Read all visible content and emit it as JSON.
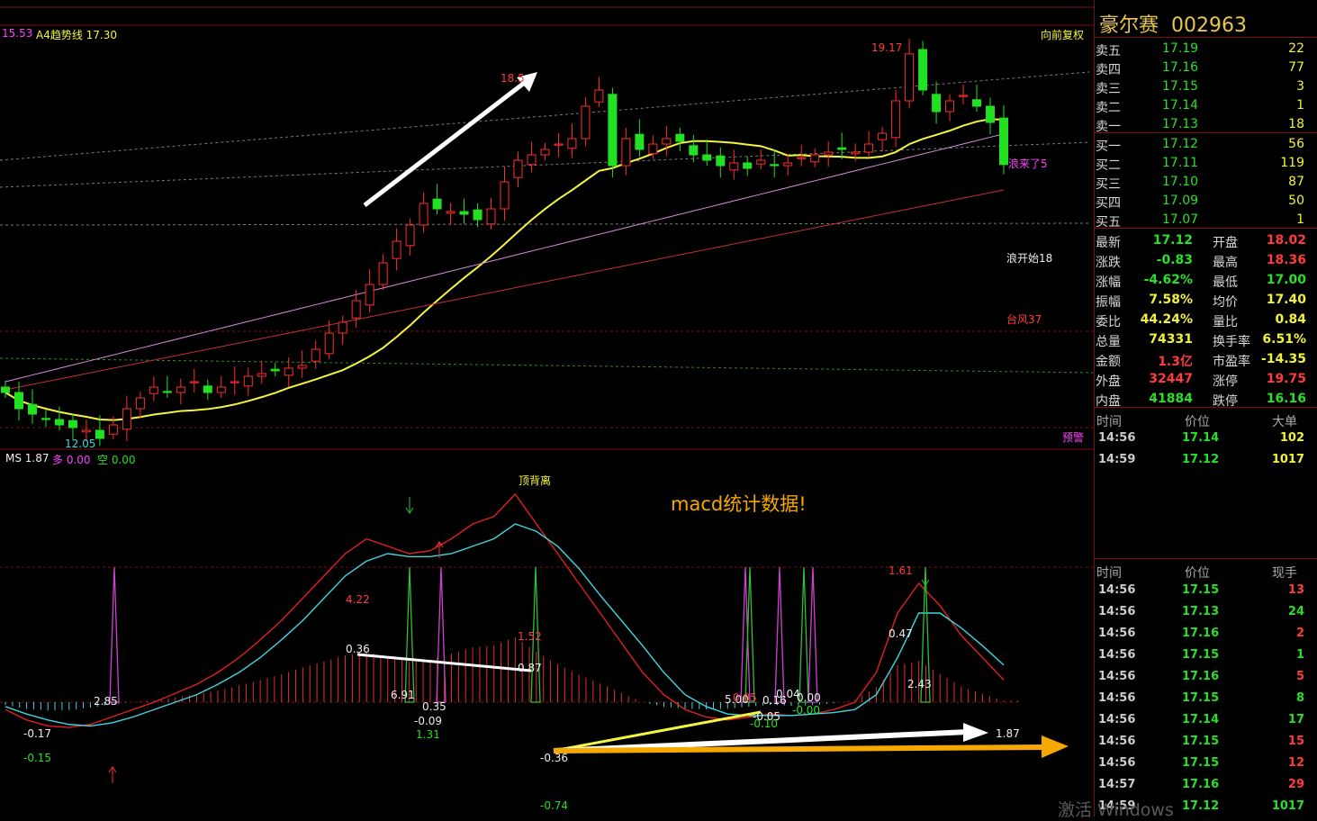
{
  "colors": {
    "up": "#ff2d2d",
    "down": "#22e022",
    "ma": "#f5f540",
    "ma_pink": "#d98ad8",
    "ma_red": "#c03030",
    "dif": "#e02020",
    "dea": "#3fd6e0",
    "accent": "#f5a800"
  },
  "header": {
    "left_value": "15.53",
    "indicator": "A4趋势线 17.30",
    "right_label": "向前复权"
  },
  "stock": {
    "name": "豪尔赛",
    "code": "002963"
  },
  "order_book": {
    "sell": [
      {
        "label": "卖五",
        "price": "17.19",
        "vol": "22"
      },
      {
        "label": "卖四",
        "price": "17.16",
        "vol": "77"
      },
      {
        "label": "卖三",
        "price": "17.15",
        "vol": "3"
      },
      {
        "label": "卖二",
        "price": "17.14",
        "vol": "1"
      },
      {
        "label": "卖一",
        "price": "17.13",
        "vol": "18"
      }
    ],
    "buy": [
      {
        "label": "买一",
        "price": "17.12",
        "vol": "56"
      },
      {
        "label": "买二",
        "price": "17.11",
        "vol": "119"
      },
      {
        "label": "买三",
        "price": "17.10",
        "vol": "87"
      },
      {
        "label": "买四",
        "price": "17.09",
        "vol": "50"
      },
      {
        "label": "买五",
        "price": "17.07",
        "vol": "1"
      }
    ]
  },
  "quote": [
    {
      "k1": "最新",
      "v1": "17.12",
      "c1": "green",
      "k2": "开盘",
      "v2": "18.02",
      "c2": "red"
    },
    {
      "k1": "涨跌",
      "v1": "-0.83",
      "c1": "green",
      "k2": "最高",
      "v2": "18.36",
      "c2": "red"
    },
    {
      "k1": "涨幅",
      "v1": "-4.62%",
      "c1": "green",
      "k2": "最低",
      "v2": "17.00",
      "c2": "green"
    },
    {
      "k1": "振幅",
      "v1": "7.58%",
      "c1": "yellow",
      "k2": "均价",
      "v2": "17.40",
      "c2": "yellow"
    },
    {
      "k1": "委比",
      "v1": "44.24%",
      "c1": "yellow",
      "k2": "量比",
      "v2": "0.84",
      "c2": "yellow"
    },
    {
      "k1": "总量",
      "v1": "74331",
      "c1": "yellow",
      "k2": "换手率",
      "v2": "6.51%",
      "c2": "yellow"
    },
    {
      "k1": "金额",
      "v1": "1.3亿",
      "c1": "red",
      "k2": "市盈率",
      "v2": "-14.35",
      "c2": "yellow"
    },
    {
      "k1": "外盘",
      "v1": "32447",
      "c1": "red",
      "k2": "涨停",
      "v2": "19.75",
      "c2": "red"
    },
    {
      "k1": "内盘",
      "v1": "41884",
      "c1": "green",
      "k2": "跌停",
      "v2": "16.16",
      "c2": "green"
    }
  ],
  "big_trades": {
    "headers": [
      "时间",
      "价位",
      "大单"
    ],
    "rows": [
      {
        "t": "14:56",
        "p": "17.14",
        "v": "102"
      },
      {
        "t": "14:59",
        "p": "17.12",
        "v": "1017"
      }
    ]
  },
  "ticks": {
    "headers": [
      "时间",
      "价位",
      "现手"
    ],
    "rows": [
      {
        "t": "14:56",
        "p": "17.15",
        "v": "13",
        "vc": "red"
      },
      {
        "t": "14:56",
        "p": "17.13",
        "v": "24",
        "vc": "green"
      },
      {
        "t": "14:56",
        "p": "17.16",
        "v": "2",
        "vc": "red"
      },
      {
        "t": "14:56",
        "p": "17.15",
        "v": "1",
        "vc": "green"
      },
      {
        "t": "14:56",
        "p": "17.16",
        "v": "5",
        "vc": "red"
      },
      {
        "t": "14:56",
        "p": "17.15",
        "v": "8",
        "vc": "green"
      },
      {
        "t": "14:56",
        "p": "17.14",
        "v": "17",
        "vc": "green"
      },
      {
        "t": "14:56",
        "p": "17.15",
        "v": "15",
        "vc": "red"
      },
      {
        "t": "14:56",
        "p": "17.15",
        "v": "12",
        "vc": "red"
      },
      {
        "t": "14:57",
        "p": "17.16",
        "v": "29",
        "vc": "red"
      },
      {
        "t": "14:59",
        "p": "17.12",
        "v": "1017",
        "vc": "green"
      }
    ]
  },
  "watermark": "激活 Windows",
  "chart_data": [
    {
      "type": "candlestick",
      "price_axis_range": [
        12.0,
        19.5
      ],
      "price_labels": {
        "low": "12.05",
        "peak1": "18.5",
        "high": "19.17",
        "last_close": "17.12"
      },
      "closes": [
        12.9,
        12.6,
        12.5,
        12.4,
        12.3,
        12.25,
        12.2,
        12.05,
        12.3,
        12.6,
        12.8,
        13.0,
        12.9,
        13.0,
        13.1,
        12.9,
        13.0,
        13.1,
        13.2,
        13.25,
        13.3,
        13.35,
        13.4,
        13.7,
        14.0,
        14.2,
        14.6,
        14.9,
        15.3,
        15.7,
        16.0,
        16.4,
        16.3,
        16.25,
        16.2,
        16.1,
        16.3,
        16.8,
        17.2,
        17.3,
        17.4,
        17.5,
        17.6,
        18.2,
        18.5,
        17.1,
        17.6,
        17.4,
        17.5,
        17.6,
        17.55,
        17.3,
        17.2,
        17.1,
        17.15,
        17.05,
        17.2,
        17.1,
        17.15,
        17.25,
        17.3,
        17.35,
        17.4,
        17.35,
        17.5,
        17.7,
        18.3,
        19.17,
        18.5,
        18.1,
        18.3,
        18.4,
        18.2,
        17.9,
        17.12
      ],
      "annotations": [
        "浪来了5",
        "浪开始18",
        "台风37",
        "预警"
      ]
    },
    {
      "type": "macd",
      "title": "MS 1.87",
      "legend": [
        {
          "label": "多 0.00",
          "color": "#ff40ff"
        },
        {
          "label": "空 0.00",
          "color": "#22e022"
        }
      ],
      "dif": [
        -0.05,
        -0.12,
        -0.16,
        -0.17,
        -0.15,
        -0.1,
        -0.05,
        0.0,
        0.06,
        0.12,
        0.2,
        0.3,
        0.42,
        0.55,
        0.7,
        0.85,
        1.0,
        1.1,
        1.05,
        1.0,
        1.02,
        1.1,
        1.2,
        1.25,
        1.4,
        1.2,
        1.0,
        0.8,
        0.6,
        0.4,
        0.2,
        0.05,
        -0.05,
        -0.1,
        -0.12,
        -0.1,
        -0.08,
        -0.09,
        -0.08,
        -0.05,
        0.0,
        0.2,
        0.6,
        0.8,
        0.65,
        0.45,
        0.3,
        0.15
      ],
      "dea": [
        -0.03,
        -0.08,
        -0.12,
        -0.15,
        -0.16,
        -0.14,
        -0.1,
        -0.05,
        0.0,
        0.05,
        0.12,
        0.2,
        0.3,
        0.42,
        0.55,
        0.7,
        0.85,
        0.95,
        1.0,
        0.98,
        0.98,
        1.0,
        1.05,
        1.1,
        1.2,
        1.15,
        1.05,
        0.9,
        0.72,
        0.55,
        0.38,
        0.2,
        0.05,
        -0.03,
        -0.08,
        -0.09,
        -0.09,
        -0.09,
        -0.08,
        -0.07,
        -0.05,
        0.05,
        0.3,
        0.6,
        0.6,
        0.5,
        0.38,
        0.25
      ],
      "labels": [
        "顶背离",
        "4.22",
        "1.52",
        "0.36",
        "0.87",
        "6.91",
        "0.35",
        "-0.09",
        "1.31",
        "-0.17",
        "-0.15",
        "2.85",
        "-0.36",
        "-0.74",
        "1.61",
        "0.47",
        "2.43",
        "1.87",
        "0.05",
        "0.16",
        "0.04",
        "0.00",
        "-0.05",
        "-0.10",
        "-0.00",
        "5.00"
      ],
      "headline": "macd统计数据!"
    }
  ]
}
